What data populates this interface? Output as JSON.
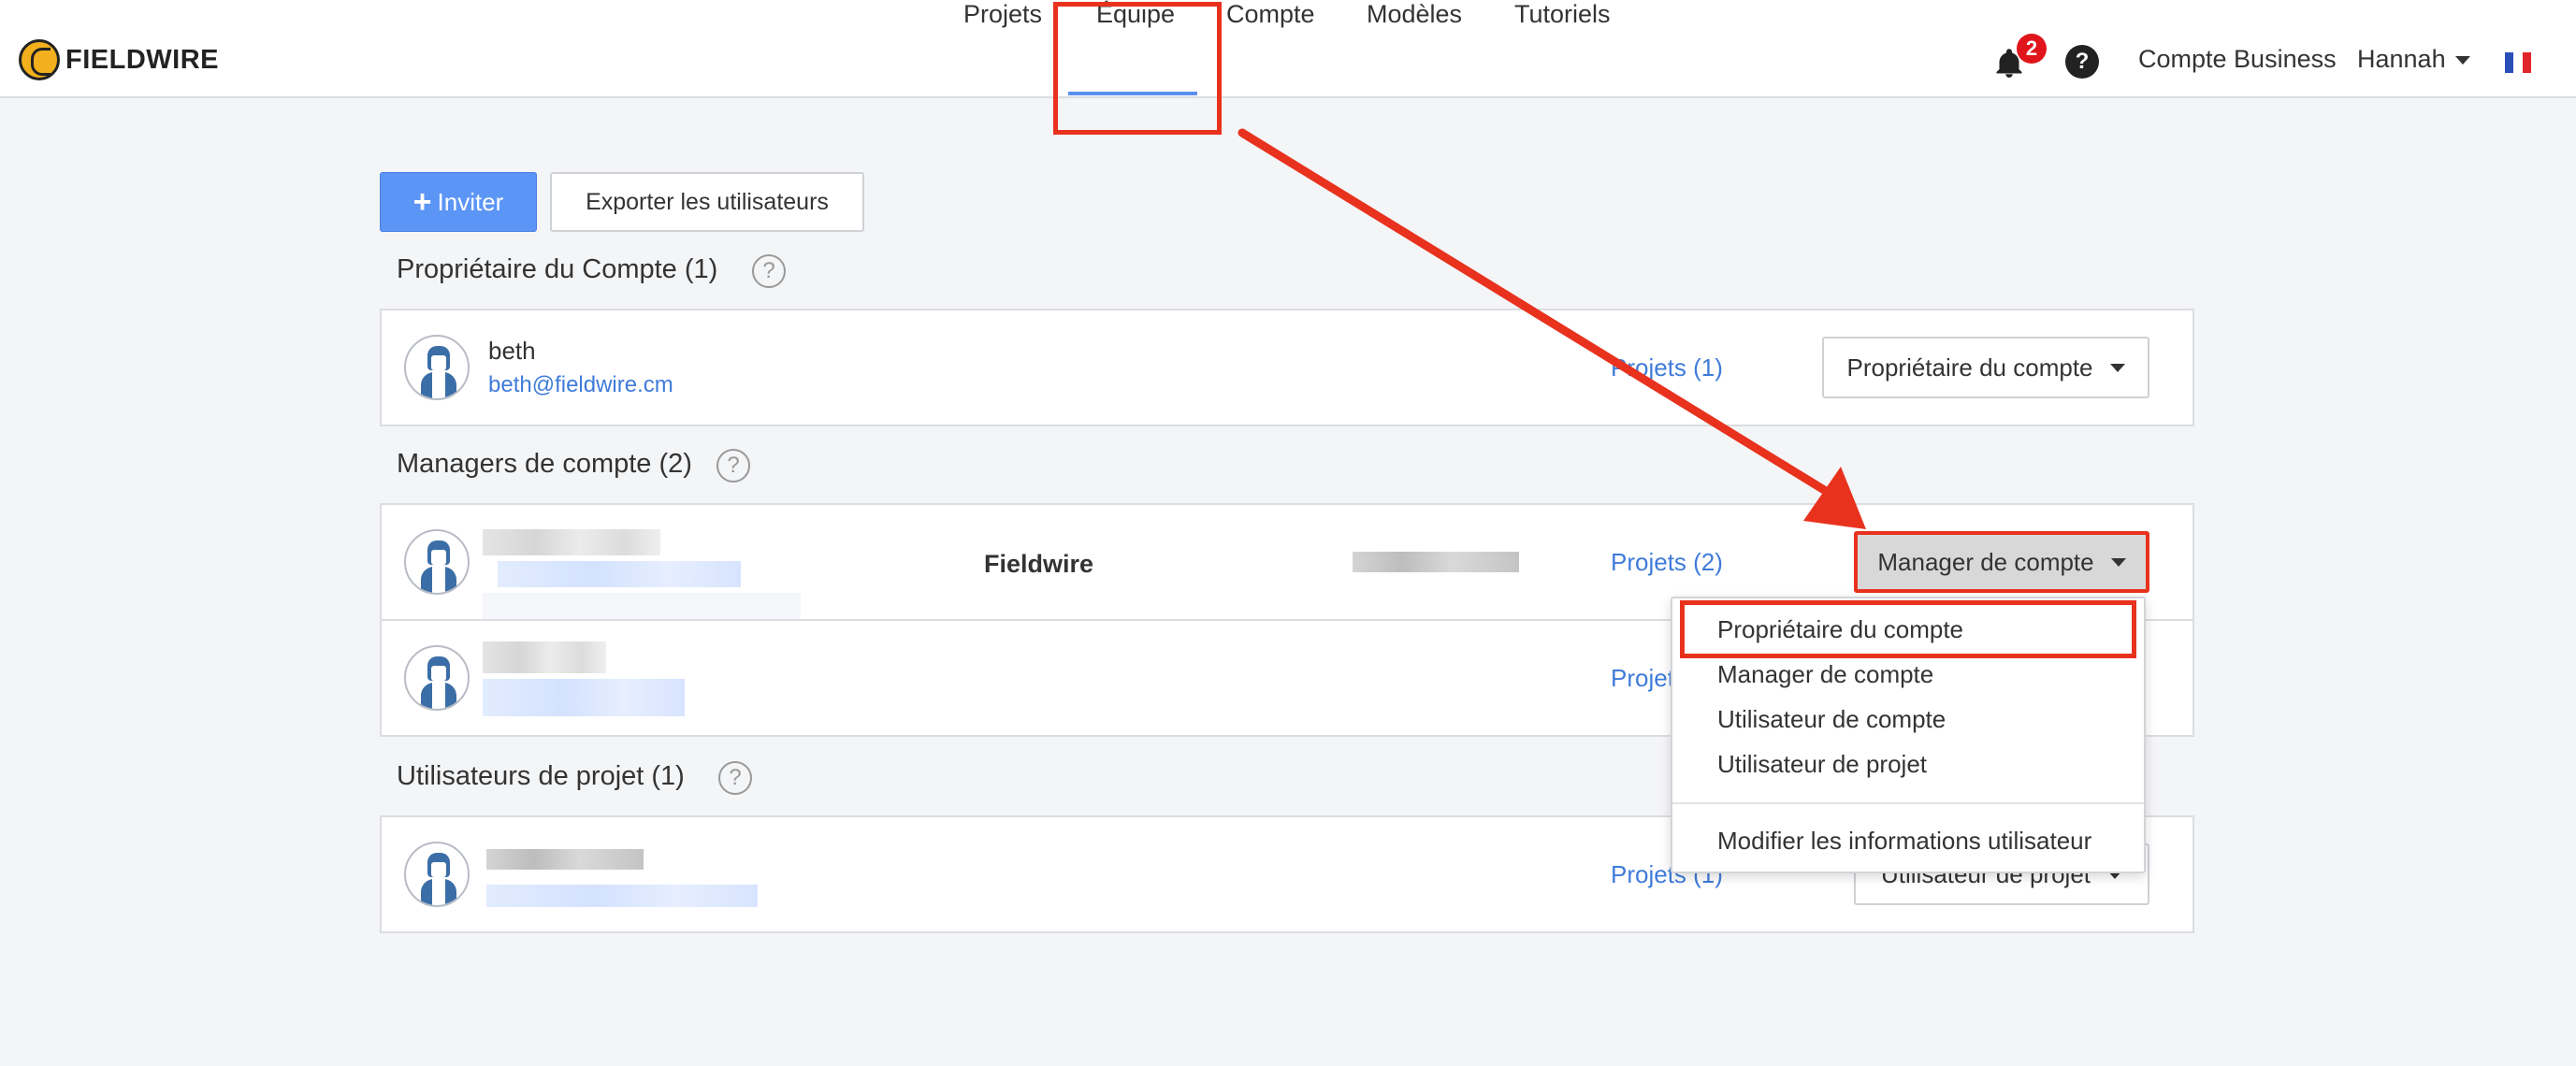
{
  "app": {
    "brand": "FIELDWIRE"
  },
  "nav": {
    "items": [
      "Projets",
      "Équipe",
      "Compte",
      "Modèles",
      "Tutoriels"
    ],
    "active": "Équipe"
  },
  "header_right": {
    "notification_count": "2",
    "help_glyph": "?",
    "business": "Compte Business",
    "user": "Hannah"
  },
  "toolbar": {
    "invite_plus": "+",
    "invite_label": "Inviter",
    "export_label": "Exporter les utilisateurs"
  },
  "sections": {
    "owner": {
      "title": "Propriétaire du Compte (1)",
      "users": [
        {
          "name": "beth",
          "email": "beth@fieldwire.cm",
          "projects": "Projets (1)",
          "role": "Propriétaire du compte"
        }
      ]
    },
    "managers": {
      "title": "Managers de compte (2)",
      "users": [
        {
          "company": "Fieldwire",
          "projects": "Projets (2)",
          "role": "Manager de compte"
        },
        {
          "projects": "Projets (1)"
        }
      ]
    },
    "project_users": {
      "title": "Utilisateurs de projet (1)",
      "users": [
        {
          "projects": "Projets (1)",
          "role": "Utilisateur de projet"
        }
      ]
    }
  },
  "help_glyph": "?",
  "role_menu": {
    "options": [
      "Propriétaire du compte",
      "Manager de compte",
      "Utilisateur de compte",
      "Utilisateur de projet"
    ],
    "footer": "Modifier les informations utilisateur"
  },
  "colors": {
    "accent": "#5b95f5",
    "link": "#3f7bd9",
    "highlight": "#e8321e",
    "badge": "#e0151b"
  }
}
